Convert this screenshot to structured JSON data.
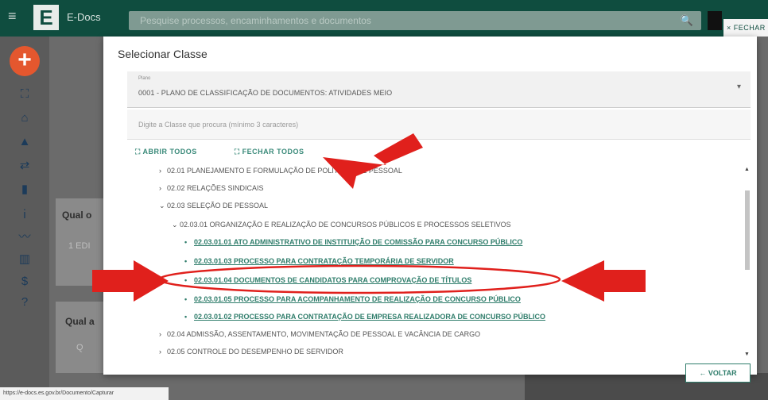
{
  "header": {
    "app_name": "E-Docs",
    "search_placeholder": "Pesquise processos, encaminhamentos e documentos",
    "close_label": "× FECHAR"
  },
  "background": {
    "heading_1": "Qual o",
    "field_1": "1 EDI",
    "heading_2": "Qual a",
    "search_glyph": "Q"
  },
  "modal": {
    "title": "Selecionar Classe",
    "plano_label": "Plano",
    "plano_value": "0001 - PLANO DE CLASSIFICAÇÃO DE DOCUMENTOS: ATIVIDADES MEIO",
    "search_placeholder": "Digite a Classe que procura (mínimo 3 caracteres)",
    "open_all": "ABRIR TODOS",
    "close_all": "FECHAR TODOS",
    "tree": [
      {
        "text": "02.01 PLANEJAMENTO E FORMULAÇÃO DE POLÍTICAS DE PESSOAL",
        "type": "node"
      },
      {
        "text": "02.02 RELAÇÕES SINDICAIS",
        "type": "node"
      },
      {
        "text": "02.03 SELEÇÃO DE PESSOAL",
        "type": "expanded"
      },
      {
        "text": "02.03.01 ORGANIZAÇÃO E REALIZAÇÃO DE CONCURSOS PÚBLICOS E PROCESSOS SELETIVOS",
        "type": "expanded"
      },
      {
        "text": "02.03.01.01 ATO ADMINISTRATIVO DE INSTITUIÇÃO DE COMISSÃO PARA CONCURSO PÚBLICO",
        "type": "leaf"
      },
      {
        "text": "02.03.01.03 PROCESSO PARA CONTRATAÇÃO TEMPORÁRIA DE SERVIDOR",
        "type": "leaf"
      },
      {
        "text": "02.03.01.04 DOCUMENTOS DE CANDIDATOS PARA COMPROVAÇÃO DE TÍTULOS",
        "type": "leaf"
      },
      {
        "text": "02.03.01.05 PROCESSO PARA ACOMPANHAMENTO DE REALIZAÇÃO DE CONCURSO PÚBLICO",
        "type": "leaf"
      },
      {
        "text": "02.03.01.02 PROCESSO PARA CONTRATAÇÃO DE EMPRESA REALIZADORA DE CONCURSO PÚBLICO",
        "type": "leaf"
      },
      {
        "text": "02.04 ADMISSÃO, ASSENTAMENTO, MOVIMENTAÇÃO DE PESSOAL E VACÂNCIA DE CARGO",
        "type": "node"
      },
      {
        "text": "02.05 CONTROLE DO DESEMPENHO DE SERVIDOR",
        "type": "node"
      }
    ],
    "back_label": "← VOLTAR"
  },
  "statusbar": "https://e-docs.es.gov.br/Documento/Capturar",
  "colors": {
    "topbar": "#0f4d3f",
    "accent": "#2f7d6b",
    "fab": "#e4572e",
    "annotation": "#e0201c"
  }
}
